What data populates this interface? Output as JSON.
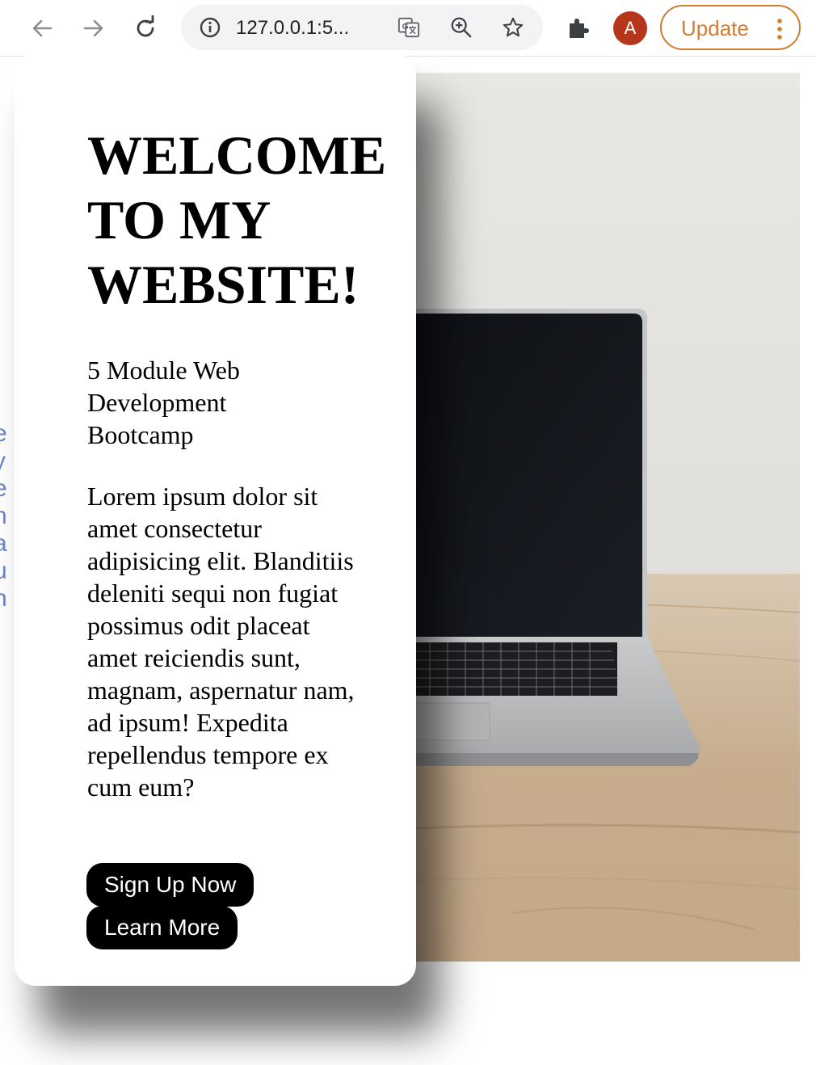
{
  "browser": {
    "url": "127.0.0.1:5...",
    "avatar_letter": "A",
    "update_label": "Update",
    "accent_color": "#d27c2e",
    "avatar_color": "#b5361a",
    "icons": [
      "back-arrow-icon",
      "forward-arrow-icon",
      "reload-icon",
      "site-info-icon",
      "translate-icon",
      "zoom-icon",
      "bookmark-star-icon",
      "extensions-puzzle-icon",
      "more-menu-icon"
    ]
  },
  "hero": {
    "title": "WELCOME TO MY WEBSITE!",
    "subtitle": "5 Module Web Development Bootcamp",
    "body": "Lorem ipsum dolor sit amet consectetur adipisicing elit. Blanditiis deleniti sequi non fugiat possimus odit placeat amet reiciendis sunt, magnam, aspernatur nam, ad ipsum! Expedita repellendus tempore ex cum eum?",
    "primary_button": "Sign Up Now",
    "secondary_button": "Learn More",
    "image_subject": "laptop-on-wooden-desk"
  }
}
